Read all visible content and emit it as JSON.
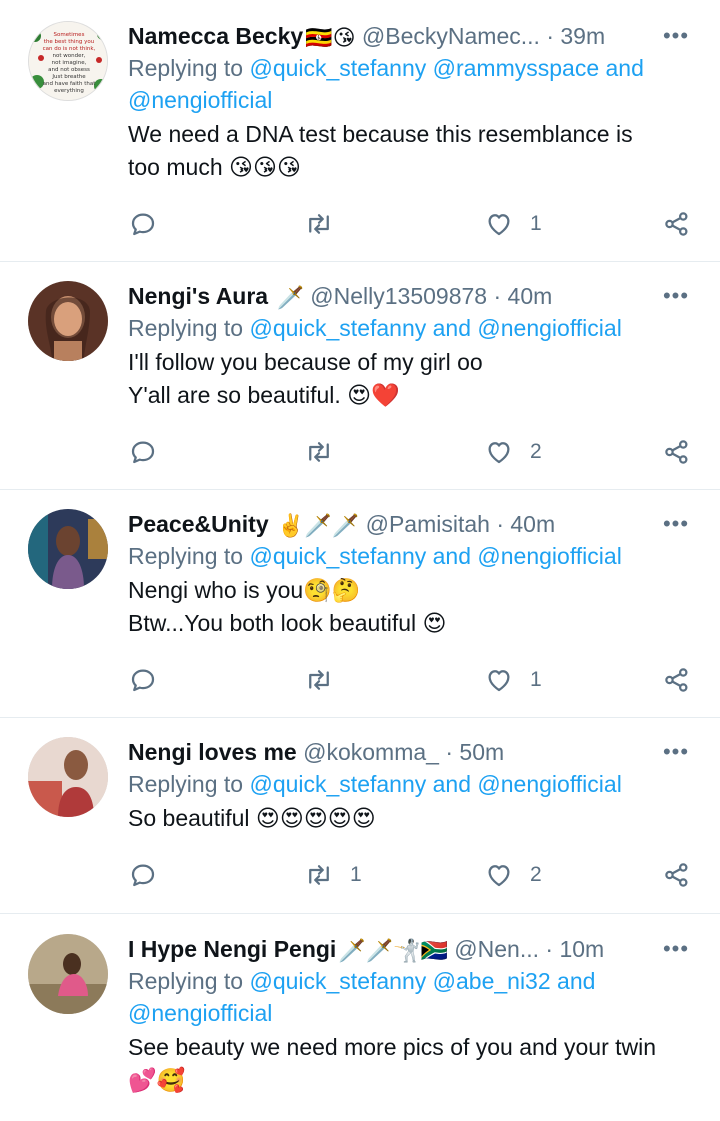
{
  "tweets": [
    {
      "name": "Namecca Becky",
      "name_emoji": "🇺🇬😘",
      "handle": "@BeckyNamec...",
      "time": "39m",
      "replying_prefix": "Replying to",
      "mentions_line1": "@quick_stefanny @rammysspace and",
      "mentions_line2": "@nengiofficial",
      "text": "We need a DNA test because this resemblance is\ntoo much 😘😘😘",
      "replies": "",
      "retweets": "",
      "likes": "1",
      "avatar_text": "Sometimes the best thing you can do is not think, not wonder, not imagine, not obsess. Just breathe and have faith that everything will work out for the best.",
      "avatar_color": "#f4f1ea"
    },
    {
      "name": "Nengi's Aura",
      "name_emoji": "🗡️",
      "handle": "@Nelly13509878",
      "time": "40m",
      "replying_prefix": "Replying to",
      "mentions_line1": "@quick_stefanny and @nengiofficial",
      "text": "I'll follow you because of my girl oo\nY'all are so beautiful. 😍❤️",
      "replies": "",
      "retweets": "",
      "likes": "2",
      "avatar_color": "#7a4a3a"
    },
    {
      "name": "Peace&Unity",
      "name_emoji": "✌️🗡️🗡️",
      "handle": "@Pamisitah",
      "time": "40m",
      "replying_prefix": "Replying to",
      "mentions_line1": "@quick_stefanny and @nengiofficial",
      "text": "Nengi who is you🧐🤔\nBtw...You both look beautiful 😍",
      "replies": "",
      "retweets": "",
      "likes": "1",
      "avatar_color": "#3b4a6b"
    },
    {
      "name": "Nengi loves me",
      "name_emoji": "",
      "handle": "@kokomma_",
      "time": "50m",
      "replying_prefix": "Replying to",
      "mentions_line1": "@quick_stefanny and @nengiofficial",
      "text": "So beautiful 😍😍😍😍😍",
      "replies": "",
      "retweets": "1",
      "likes": "2",
      "avatar_color": "#d8bcb0"
    },
    {
      "name": "I Hype Nengi Pengi",
      "name_emoji": "🗡️🗡️🤺🇿🇦",
      "handle": "@Nen...",
      "time": "10m",
      "replying_prefix": "Replying to",
      "mentions_line1": "@quick_stefanny @abe_ni32 and",
      "mentions_line2": "@nengiofficial",
      "text": "See beauty we need more pics of you and your twin\n💕🥰",
      "replies": "",
      "retweets": "",
      "likes": "",
      "avatar_color": "#a08d6f"
    }
  ],
  "icons": {
    "more": "more-horizontal-icon",
    "reply": "reply-icon",
    "retweet": "retweet-icon",
    "like": "heart-icon",
    "share": "share-icon"
  },
  "colors": {
    "link": "#1da1f2",
    "muted": "#5b7083",
    "divider": "#e6ecf0"
  }
}
